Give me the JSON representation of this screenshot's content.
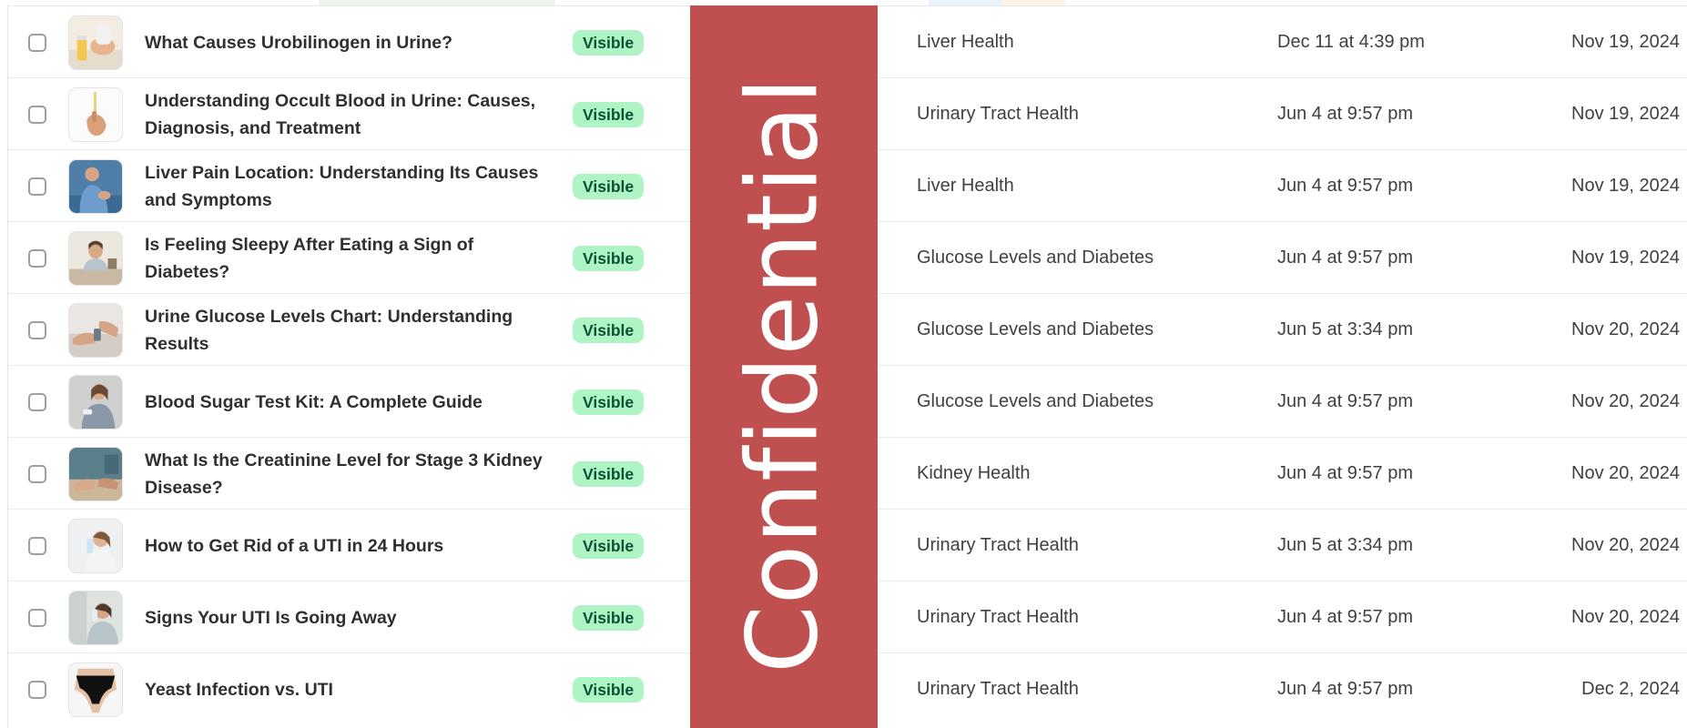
{
  "rows": [
    {
      "title": "What Causes Urobilinogen in Urine?",
      "status": "Visible",
      "category": "Liver Health",
      "updated": "Dec 11 at 4:39 pm",
      "published": "Nov 19, 2024",
      "thumb_icon": "urine-sample-photo"
    },
    {
      "title": "Understanding Occult Blood in Urine: Causes, Diagnosis, and Treatment",
      "status": "Visible",
      "category": "Urinary Tract Health",
      "updated": "Jun 4 at 9:57 pm",
      "published": "Nov 19, 2024",
      "thumb_icon": "hand-test-strip-photo"
    },
    {
      "title": "Liver Pain Location: Understanding Its Causes and Symptoms",
      "status": "Visible",
      "category": "Liver Health",
      "updated": "Jun 4 at 9:57 pm",
      "published": "Nov 19, 2024",
      "thumb_icon": "man-side-pain-photo"
    },
    {
      "title": "Is Feeling Sleepy After Eating a Sign of Diabetes?",
      "status": "Visible",
      "category": "Glucose Levels and Diabetes",
      "updated": "Jun 4 at 9:57 pm",
      "published": "Nov 19, 2024",
      "thumb_icon": "sleepy-woman-desk-photo"
    },
    {
      "title": "Urine Glucose Levels Chart: Understanding Results",
      "status": "Visible",
      "category": "Glucose Levels and Diabetes",
      "updated": "Jun 5 at 3:34 pm",
      "published": "Nov 20, 2024",
      "thumb_icon": "glucose-test-hands-photo"
    },
    {
      "title": "Blood Sugar Test Kit: A Complete Guide",
      "status": "Visible",
      "category": "Glucose Levels and Diabetes",
      "updated": "Jun 4 at 9:57 pm",
      "published": "Nov 20, 2024",
      "thumb_icon": "woman-test-kit-photo"
    },
    {
      "title": "What Is the Creatinine Level for Stage 3 Kidney Disease?",
      "status": "Visible",
      "category": "Kidney Health",
      "updated": "Jun 4 at 9:57 pm",
      "published": "Nov 20, 2024",
      "thumb_icon": "consultation-hands-photo"
    },
    {
      "title": "How to Get Rid of a UTI in 24 Hours",
      "status": "Visible",
      "category": "Urinary Tract Health",
      "updated": "Jun 5 at 3:34 pm",
      "published": "Nov 20, 2024",
      "thumb_icon": "woman-drinking-water-photo"
    },
    {
      "title": "Signs Your UTI Is Going Away",
      "status": "Visible",
      "category": "Urinary Tract Health",
      "updated": "Jun 4 at 9:57 pm",
      "published": "Nov 20, 2024",
      "thumb_icon": "woman-drinking-photo"
    },
    {
      "title": "Yeast Infection vs. UTI",
      "status": "Visible",
      "category": "Urinary Tract Health",
      "updated": "Jun 4 at 9:57 pm",
      "published": "Dec 2, 2024",
      "thumb_icon": "underwear-photo"
    }
  ],
  "watermark": {
    "text": "Confidential",
    "color": "#c05050"
  },
  "colors": {
    "badge_bg": "#aff4c5",
    "badge_text": "#0c5132",
    "row_border": "#ebebeb"
  }
}
